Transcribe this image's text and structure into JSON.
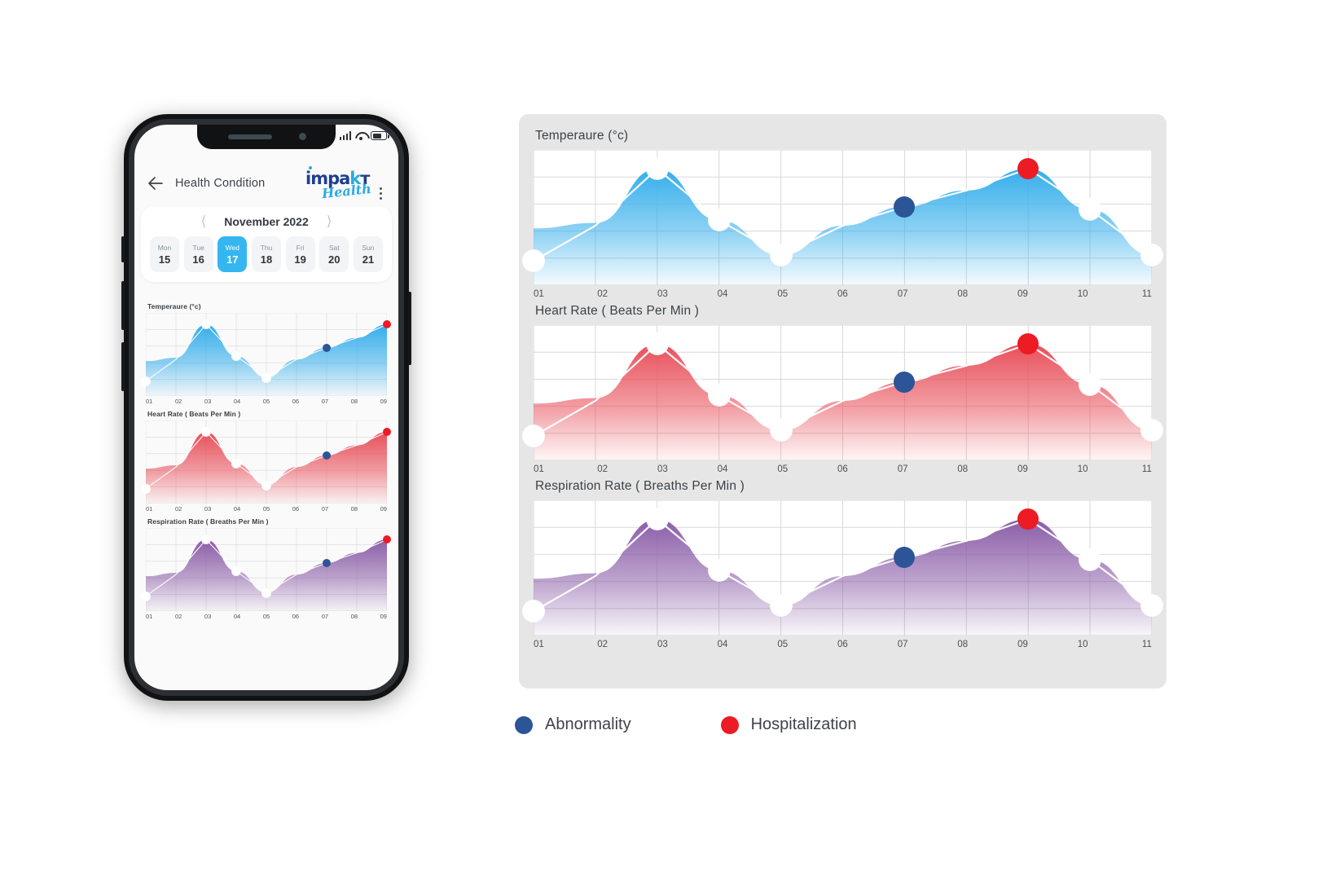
{
  "phone": {
    "status_bar": {
      "signal_icon": "signal-bars-icon",
      "wifi_icon": "wifi-icon",
      "battery_icon": "battery-icon"
    },
    "header": {
      "back_icon": "back-arrow-icon",
      "title": "Health Condition",
      "logo_primary": "impakt",
      "logo_secondary": "Health",
      "menu_icon": "kebab-menu-icon"
    },
    "calendar": {
      "prev_icon": "chevron-left-icon",
      "next_icon": "chevron-right-icon",
      "month": "November 2022",
      "days": [
        {
          "weekday": "Mon",
          "date": "15",
          "selected": false
        },
        {
          "weekday": "Tue",
          "date": "16",
          "selected": false
        },
        {
          "weekday": "Wed",
          "date": "17",
          "selected": true
        },
        {
          "weekday": "Thu",
          "date": "18",
          "selected": false
        },
        {
          "weekday": "Fri",
          "date": "19",
          "selected": false
        },
        {
          "weekday": "Sat",
          "date": "20",
          "selected": false
        },
        {
          "weekday": "Sun",
          "date": "21",
          "selected": false
        }
      ]
    },
    "mini_axis_labels": [
      "01",
      "02",
      "03",
      "04",
      "05",
      "06",
      "07",
      "08",
      "09"
    ]
  },
  "panel": {
    "charts": [
      {
        "title": "Temperaure (°c)"
      },
      {
        "title": "Heart Rate ( Beats Per Min )"
      },
      {
        "title": "Respiration Rate ( Breaths Per Min )"
      }
    ]
  },
  "legend": {
    "items": [
      {
        "label": "Abnormality",
        "color": "#2b5597",
        "icon": "abnormality-dot-icon"
      },
      {
        "label": "Hospitalization",
        "color": "#ec1b24",
        "icon": "hospitalization-dot-icon"
      }
    ]
  },
  "colors": {
    "temperature": "#35aeeb",
    "heart_rate": "#e8505b",
    "respiration": "#8b5ea8",
    "abnormality": "#2b5597",
    "hospitalization": "#ec1b24",
    "panel_bg": "#e6e6e6",
    "accent": "#35b6f0",
    "logo_dark": "#1f3f8f"
  },
  "chart_data": [
    {
      "type": "area",
      "title": "Temperaure (°c)",
      "xlabel": "",
      "ylabel": "",
      "categories": [
        "01",
        "02",
        "03",
        "04",
        "05",
        "06",
        "07",
        "08",
        "09",
        "10",
        "11"
      ],
      "x": [
        1,
        2,
        3,
        4,
        5,
        6,
        7,
        8,
        9,
        10,
        11
      ],
      "values": [
        18,
        44,
        86,
        48,
        22,
        44,
        58,
        70,
        86,
        56,
        22
      ],
      "ylim": [
        0,
        100
      ],
      "xlim": [
        1,
        11
      ],
      "grid": true,
      "legend_position": "below-figure",
      "area_fill": "gradient blue to transparent",
      "color": "#35aeeb",
      "markers": [
        {
          "x": "01",
          "value": 18,
          "kind": "normal"
        },
        {
          "x": "03",
          "value": 86,
          "kind": "normal"
        },
        {
          "x": "04",
          "value": 48,
          "kind": "normal"
        },
        {
          "x": "05",
          "value": 22,
          "kind": "normal"
        },
        {
          "x": "07",
          "value": 58,
          "kind": "abnormality"
        },
        {
          "x": "09",
          "value": 86,
          "kind": "hospitalization"
        },
        {
          "x": "10",
          "value": 56,
          "kind": "normal"
        },
        {
          "x": "11",
          "value": 22,
          "kind": "normal"
        }
      ]
    },
    {
      "type": "area",
      "title": "Heart Rate ( Beats Per Min )",
      "xlabel": "",
      "ylabel": "",
      "categories": [
        "01",
        "02",
        "03",
        "04",
        "05",
        "06",
        "07",
        "08",
        "09",
        "10",
        "11"
      ],
      "x": [
        1,
        2,
        3,
        4,
        5,
        6,
        7,
        8,
        9,
        10,
        11
      ],
      "values": [
        18,
        44,
        86,
        48,
        22,
        44,
        58,
        70,
        86,
        56,
        22
      ],
      "ylim": [
        0,
        100
      ],
      "xlim": [
        1,
        11
      ],
      "grid": true,
      "legend_position": "below-figure",
      "area_fill": "gradient red to transparent",
      "color": "#e8505b",
      "markers": [
        {
          "x": "01",
          "value": 18,
          "kind": "normal"
        },
        {
          "x": "03",
          "value": 86,
          "kind": "normal"
        },
        {
          "x": "04",
          "value": 48,
          "kind": "normal"
        },
        {
          "x": "05",
          "value": 22,
          "kind": "normal"
        },
        {
          "x": "07",
          "value": 58,
          "kind": "abnormality"
        },
        {
          "x": "09",
          "value": 86,
          "kind": "hospitalization"
        },
        {
          "x": "10",
          "value": 56,
          "kind": "normal"
        },
        {
          "x": "11",
          "value": 22,
          "kind": "normal"
        }
      ]
    },
    {
      "type": "area",
      "title": "Respiration Rate ( Breaths Per Min )",
      "xlabel": "",
      "ylabel": "",
      "categories": [
        "01",
        "02",
        "03",
        "04",
        "05",
        "06",
        "07",
        "08",
        "09",
        "10",
        "11"
      ],
      "x": [
        1,
        2,
        3,
        4,
        5,
        6,
        7,
        8,
        9,
        10,
        11
      ],
      "values": [
        18,
        44,
        86,
        48,
        22,
        44,
        58,
        70,
        86,
        56,
        22
      ],
      "ylim": [
        0,
        100
      ],
      "xlim": [
        1,
        11
      ],
      "grid": true,
      "legend_position": "below-figure",
      "area_fill": "gradient purple to transparent",
      "color": "#8b5ea8",
      "markers": [
        {
          "x": "01",
          "value": 18,
          "kind": "normal"
        },
        {
          "x": "03",
          "value": 86,
          "kind": "normal"
        },
        {
          "x": "04",
          "value": 48,
          "kind": "normal"
        },
        {
          "x": "05",
          "value": 22,
          "kind": "normal"
        },
        {
          "x": "07",
          "value": 58,
          "kind": "abnormality"
        },
        {
          "x": "09",
          "value": 86,
          "kind": "hospitalization"
        },
        {
          "x": "10",
          "value": 56,
          "kind": "normal"
        },
        {
          "x": "11",
          "value": 22,
          "kind": "normal"
        }
      ]
    }
  ]
}
